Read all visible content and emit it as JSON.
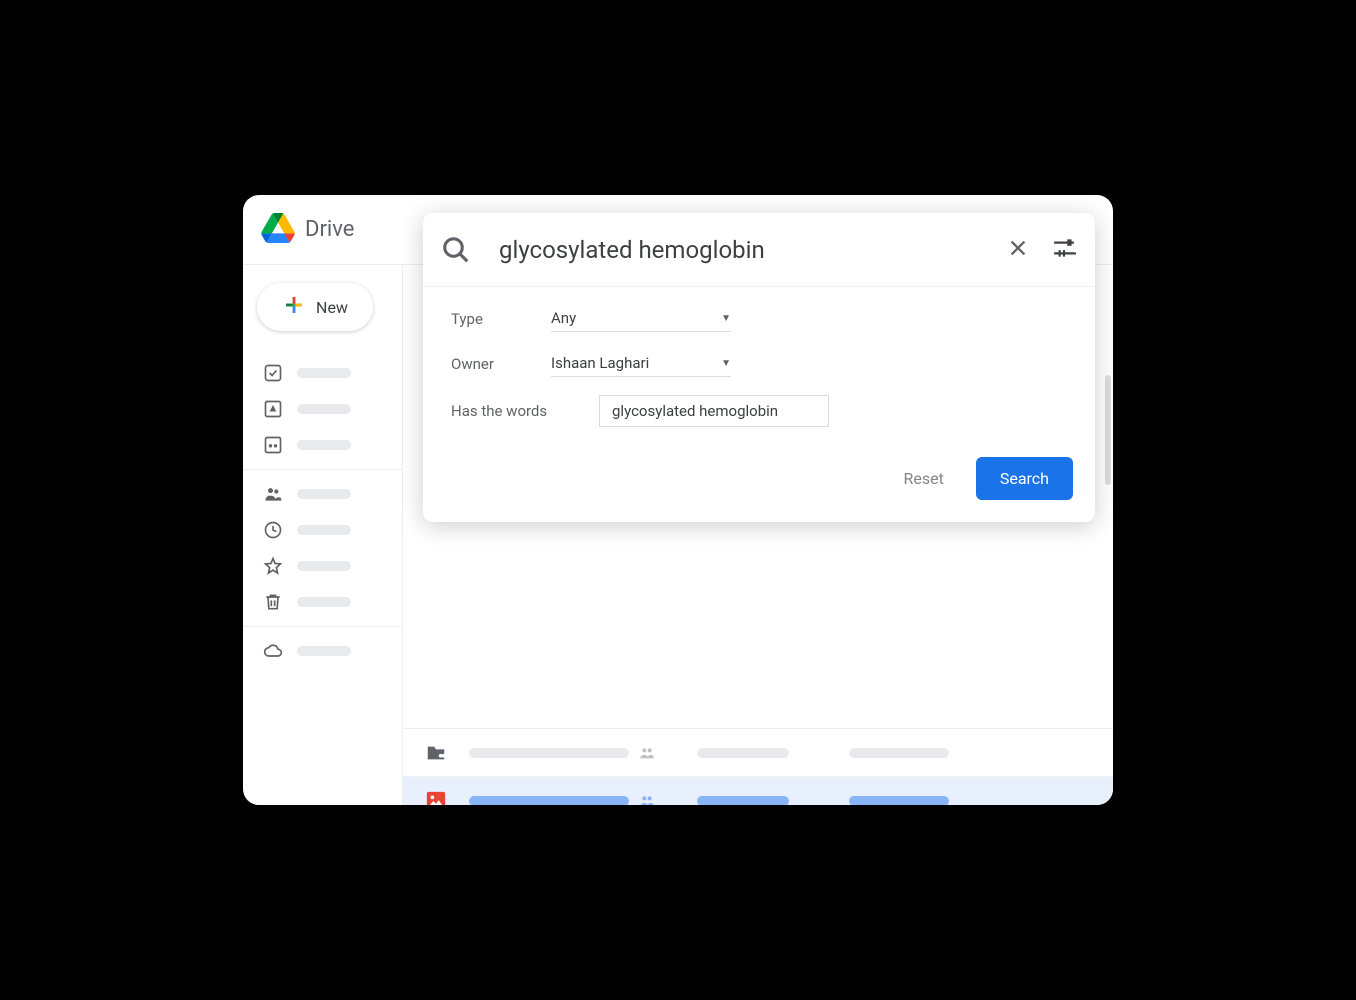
{
  "app_name": "Drive",
  "new_button": "New",
  "search": {
    "query": "glycosylated hemoglobin",
    "filters": {
      "type_label": "Type",
      "type_value": "Any",
      "owner_label": "Owner",
      "owner_value": "Ishaan Laghari",
      "words_label": "Has the words",
      "words_value": "glycosylated hemoglobin"
    },
    "reset": "Reset",
    "search_btn": "Search"
  }
}
